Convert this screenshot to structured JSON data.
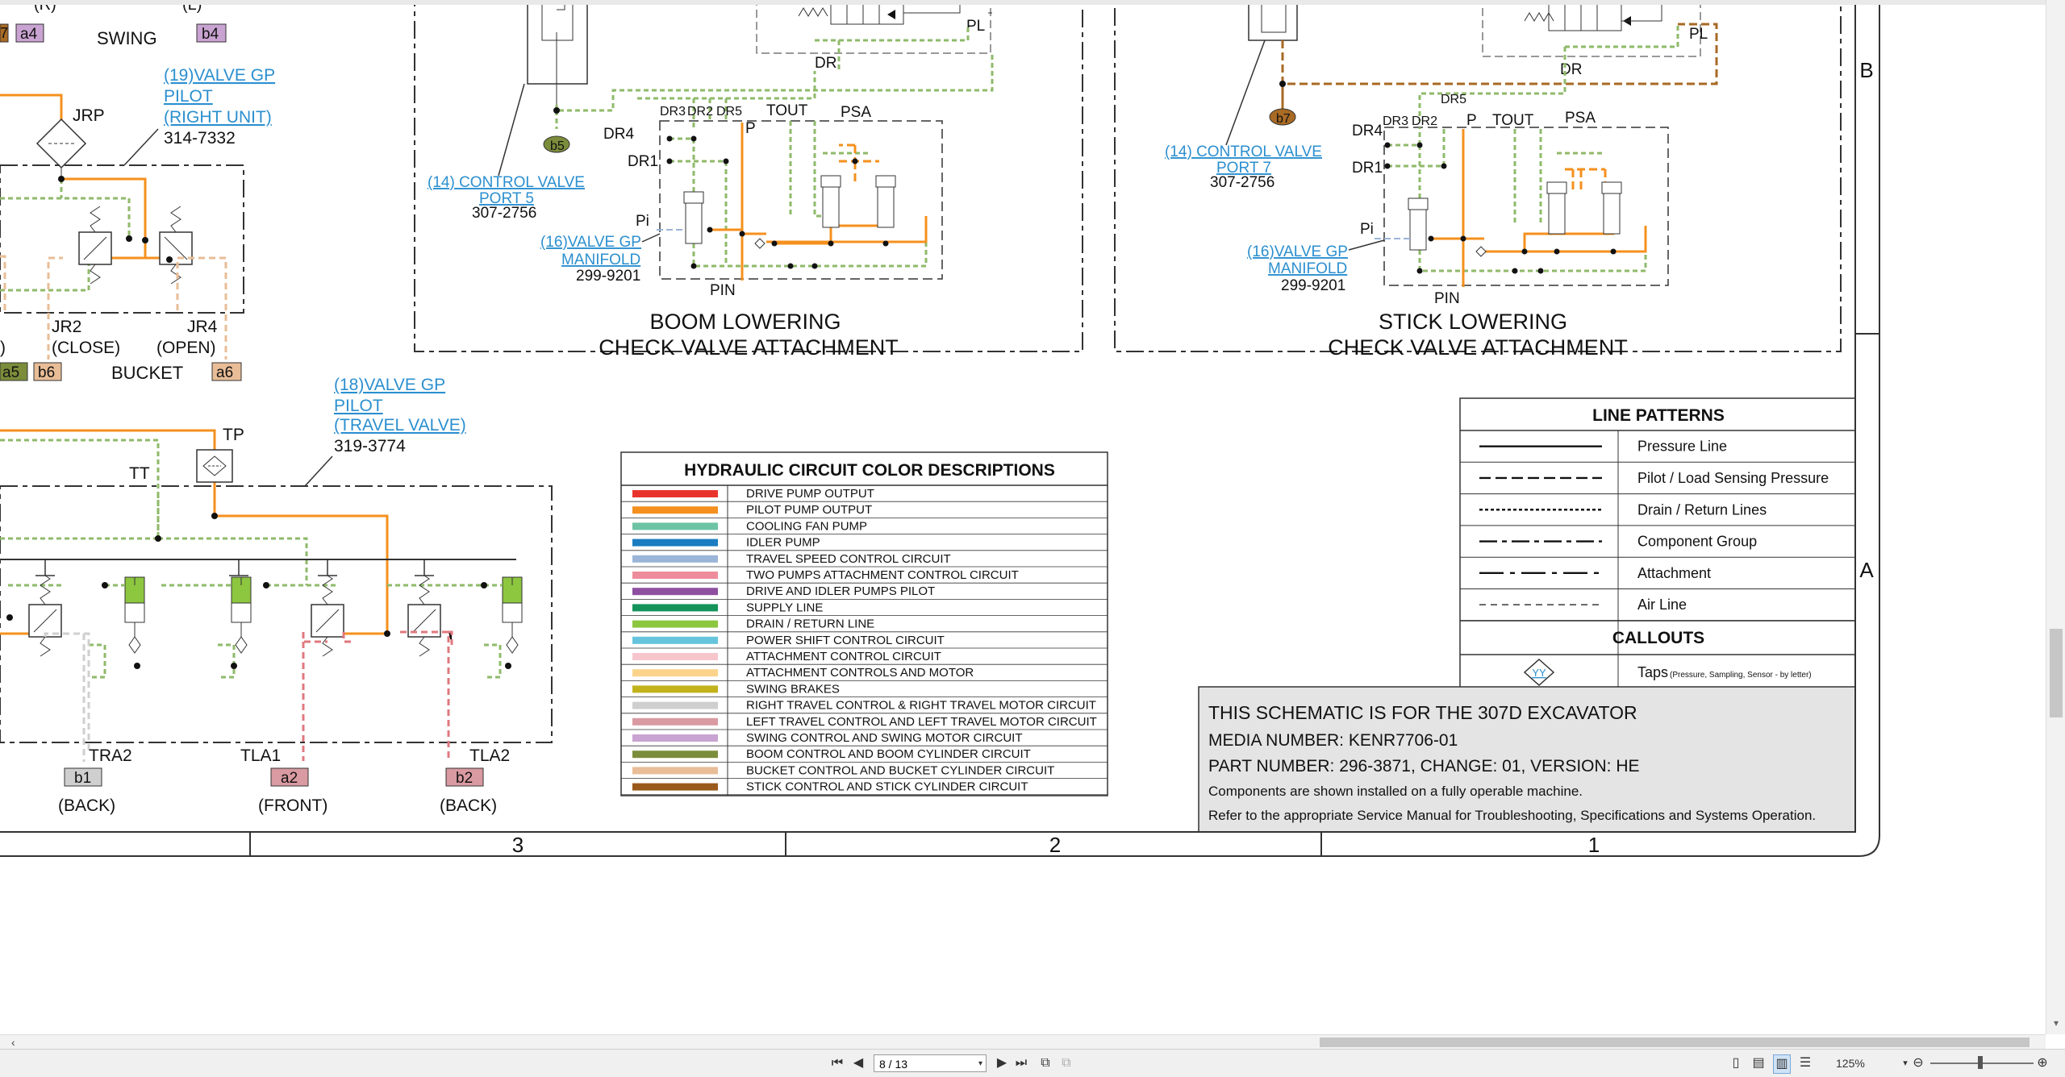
{
  "viewer": {
    "page_current": "8",
    "page_total": "13",
    "page_display": "8 / 13",
    "zoom": "125%",
    "zoom_level_percent": 125
  },
  "schematic": {
    "top_labels": {
      "r": "(R)",
      "l": "(L)",
      "swing": "SWING",
      "a4": "a4",
      "b4": "b4",
      "seven": "7"
    },
    "valve19": {
      "callout": "(19)VALVE GP",
      "l2": "PILOT",
      "l3": "(RIGHT UNIT)",
      "part": "314-7332",
      "jrp": "JRP",
      "jr2": "JR2",
      "jr2_sub": "(CLOSE)",
      "jr4": "JR4",
      "jr4_sub": "(OPEN)",
      "bucket": "BUCKET",
      "a5": "a5",
      "b6": "b6",
      "a6": "a6",
      "paren": ")"
    },
    "valve18": {
      "callout": "(18)VALVE GP",
      "l2": "PILOT",
      "l3": "(TRAVEL VALVE)",
      "part": "319-3774",
      "tp": "TP",
      "tt": "TT",
      "tra2": "TRA2",
      "tla1": "TLA1",
      "tla2": "TLA2",
      "b1": "b1",
      "a2": "a2",
      "b2": "b2",
      "back1": "(BACK)",
      "front": "(FRONT)",
      "back2": "(BACK)"
    },
    "boom": {
      "cv": "(14) CONTROL VALVE",
      "cv2": "PORT 5",
      "cv_part": "307-2756",
      "b5": "b5",
      "mf": "(16)VALVE GP",
      "mf2": "MANIFOLD",
      "mf_part": "299-9201",
      "dr": "DR",
      "pl": "PL",
      "dr3": "DR3",
      "dr2": "DR2",
      "dr5": "DR5",
      "p": "P",
      "tout": "TOUT",
      "psa": "PSA",
      "dr4": "DR4",
      "dr1": "DR1",
      "pi": "Pi",
      "pin": "PIN",
      "title1": "BOOM LOWERING",
      "title2": "CHECK VALVE ATTACHMENT"
    },
    "stick": {
      "cv": "(14) CONTROL VALVE",
      "cv2": "PORT 7",
      "cv_part": "307-2756",
      "b7": "b7",
      "mf": "(16)VALVE GP",
      "mf2": "MANIFOLD",
      "mf_part": "299-9201",
      "dr": "DR",
      "pl": "PL",
      "dr5": "DR5",
      "dr3": "DR3",
      "dr2": "DR2",
      "p": "P",
      "tout": "TOUT",
      "psa": "PSA",
      "dr4": "DR4",
      "dr1": "DR1",
      "pi": "Pi",
      "pin": "PIN",
      "title1": "STICK LOWERING",
      "title2": "CHECK VALVE ATTACHMENT"
    },
    "zones": {
      "b": "B",
      "a": "A",
      "col3": "3",
      "col2": "2",
      "col1": "1"
    }
  },
  "color_legend": {
    "title": "HYDRAULIC CIRCUIT COLOR DESCRIPTIONS",
    "items": [
      {
        "label": "DRIVE PUMP OUTPUT",
        "color": "#e8332c"
      },
      {
        "label": "PILOT PUMP OUTPUT",
        "color": "#f5901e"
      },
      {
        "label": "COOLING FAN PUMP",
        "color": "#6cc4a4"
      },
      {
        "label": "IDLER PUMP",
        "color": "#1a7dc1"
      },
      {
        "label": "TRAVEL SPEED CONTROL CIRCUIT",
        "color": "#9bb5d8"
      },
      {
        "label": "TWO PUMPS ATTACHMENT CONTROL CIRCUIT",
        "color": "#ef8c9b"
      },
      {
        "label": "DRIVE AND IDLER PUMPS PILOT",
        "color": "#8e4fa1"
      },
      {
        "label": "SUPPLY LINE",
        "color": "#14945a"
      },
      {
        "label": "DRAIN / RETURN LINE",
        "color": "#8dc63f"
      },
      {
        "label": "POWER SHIFT CONTROL CIRCUIT",
        "color": "#66c5dd"
      },
      {
        "label": "ATTACHMENT CONTROL CIRCUIT",
        "color": "#f7c6cd"
      },
      {
        "label": "ATTACHMENT CONTROLS AND MOTOR",
        "color": "#fbd38a"
      },
      {
        "label": "SWING BRAKES",
        "color": "#c2b21b"
      },
      {
        "label": "RIGHT TRAVEL CONTROL & RIGHT TRAVEL MOTOR CIRCUIT",
        "color": "#cfcfcf"
      },
      {
        "label": "LEFT TRAVEL CONTROL AND LEFT TRAVEL MOTOR CIRCUIT",
        "color": "#d99aa1"
      },
      {
        "label": "SWING CONTROL AND SWING MOTOR CIRCUIT",
        "color": "#c9a3d1"
      },
      {
        "label": "BOOM CONTROL AND BOOM CYLINDER CIRCUIT",
        "color": "#7b8d3b"
      },
      {
        "label": "BUCKET CONTROL AND BUCKET CYLINDER CIRCUIT",
        "color": "#e8bd97"
      },
      {
        "label": "STICK CONTROL AND STICK CYLINDER CIRCUIT",
        "color": "#9a5a1c"
      }
    ]
  },
  "line_patterns": {
    "title": "LINE PATTERNS",
    "items": [
      {
        "label": "Pressure Line",
        "style": "solid"
      },
      {
        "label": "Pilot / Load Sensing Pressure",
        "style": "dashed"
      },
      {
        "label": "Drain / Return Lines",
        "style": "dotted"
      },
      {
        "label": "Component Group",
        "style": "dashdot"
      },
      {
        "label": "Attachment",
        "style": "dashlong"
      },
      {
        "label": "Air Line",
        "style": "thin-dashed"
      }
    ],
    "callouts_title": "CALLOUTS",
    "tap_symbol": "YY",
    "tap_label": "Taps",
    "tap_note": "(Pressure, Sampling, Sensor - by letter)"
  },
  "info_box": {
    "line1": "THIS SCHEMATIC IS FOR THE 307D EXCAVATOR",
    "line2": "MEDIA NUMBER: KENR7706-01",
    "line3": "PART NUMBER: 296-3871, CHANGE: 01, VERSION: HE",
    "line4": "Components are shown installed on a fully operable machine.",
    "line5": "Refer to the appropriate Service Manual for Troubleshooting, Specifications and Systems Operation."
  },
  "colors": {
    "orange": "#f5901e",
    "green_dash": "#8fba6a",
    "stick_brown": "#a86a24",
    "link_blue": "#2b8fcf",
    "pink_dash": "#e0787f",
    "info_bg": "#e4e4e4"
  }
}
